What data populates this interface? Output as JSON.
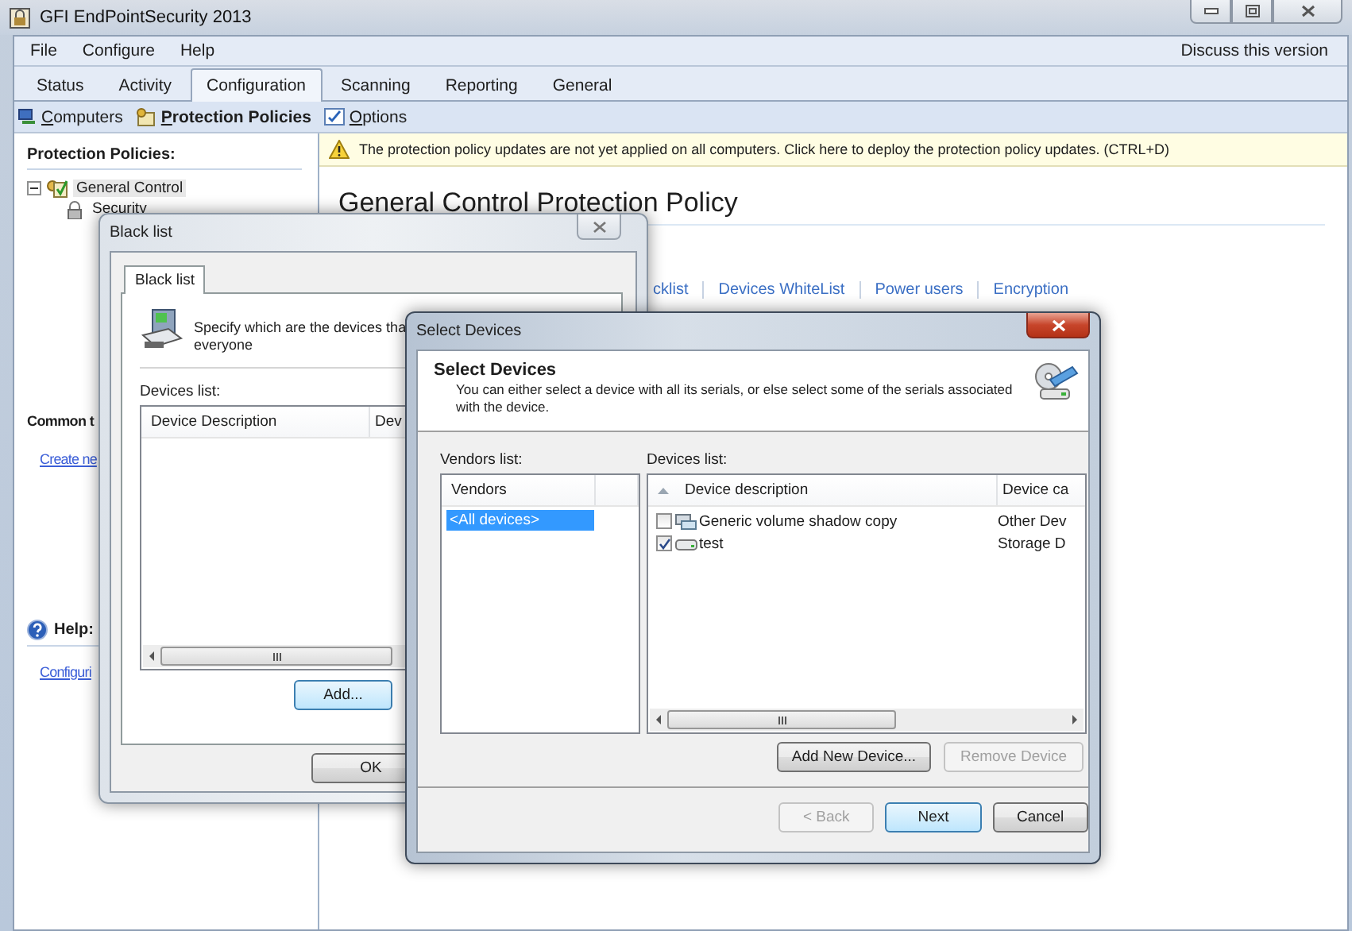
{
  "window": {
    "title": "GFI EndPointSecurity 2013"
  },
  "menu": [
    "File",
    "Configure",
    "Help"
  ],
  "menu_link": "Discuss this version",
  "tabs": [
    {
      "label": "Status",
      "selected": false
    },
    {
      "label": "Activity",
      "selected": false
    },
    {
      "label": "Configuration",
      "selected": true
    },
    {
      "label": "Scanning",
      "selected": false
    },
    {
      "label": "Reporting",
      "selected": false
    },
    {
      "label": "General",
      "selected": false
    }
  ],
  "subtabs": [
    {
      "label": "Computers",
      "kind": "computers",
      "selected": false
    },
    {
      "label": "Protection Policies",
      "kind": "policies",
      "selected": true
    },
    {
      "label": "Options",
      "kind": "options",
      "selected": false
    }
  ],
  "sidebar": {
    "heading": "Protection Policies:",
    "tree": [
      {
        "label": "General Control",
        "selected": true,
        "expanded": true,
        "children": [
          {
            "label": "Security",
            "selected": false
          }
        ]
      }
    ],
    "common_heading": "Common t",
    "common_link": "Create ne",
    "help_heading": "Help:",
    "help_link": "Configuri"
  },
  "notice": "The protection policy updates are not yet applied on all computers. Click here to deploy the protection policy updates. (CTRL+D)",
  "main": {
    "title": "General Control Protection Policy",
    "links": [
      "cklist",
      "Devices WhiteList",
      "Power users",
      "Encryption"
    ]
  },
  "blacklist_dialog": {
    "title": "Black list",
    "tab": "Black list",
    "description": [
      "Specify which are the devices tha",
      "everyone"
    ],
    "devices_label": "Devices list:",
    "columns": [
      "Device Description",
      "Dev"
    ],
    "buttons": [
      {
        "label": "Add...",
        "default": true
      },
      {
        "label": "OK",
        "default": false
      }
    ]
  },
  "select_dialog": {
    "title": "Select Devices",
    "heading": "Select Devices",
    "description": "You can either select a device with all its serials, or else select some of the serials associated with the device.",
    "vendors_label": "Vendors list:",
    "vendors_column": "Vendors",
    "vendors": [
      {
        "label": "<All devices>",
        "selected": true
      }
    ],
    "devices_label": "Devices list:",
    "columns": [
      "Device description",
      "Device ca"
    ],
    "devices": [
      {
        "description": "Generic volume shadow copy",
        "category": "Other Dev",
        "kind": "shadow",
        "checked": false
      },
      {
        "description": "test",
        "category": "Storage D",
        "kind": "drive",
        "checked": true
      }
    ],
    "buttons": [
      {
        "label": "Add New Device...",
        "disabled": false
      },
      {
        "label": "Remove Device",
        "disabled": true
      }
    ],
    "nav_buttons": [
      {
        "label": "< Back",
        "disabled": true,
        "default": false
      },
      {
        "label": "Next",
        "disabled": false,
        "default": true
      },
      {
        "label": "Cancel",
        "disabled": false,
        "default": false
      }
    ]
  }
}
